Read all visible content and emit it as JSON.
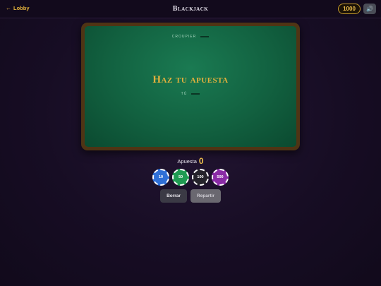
{
  "header": {
    "back_label": "Lobby",
    "back_icon": "arrow-left-icon",
    "title": "Blackjack",
    "credits": "1000",
    "sound_icon": "speaker-icon"
  },
  "table": {
    "dealer_label": "CROUPIER",
    "prompt": "Haz tu apuesta",
    "player_label": "TÚ"
  },
  "bet": {
    "label": "Apuesta",
    "amount": "0"
  },
  "chips": [
    {
      "value": "10",
      "color": "#2f6fd6"
    },
    {
      "value": "50",
      "color": "#1f9a52"
    },
    {
      "value": "100",
      "color": "#25232b"
    },
    {
      "value": "500",
      "color": "#8a2ba6"
    }
  ],
  "actions": {
    "clear_label": "Borrar",
    "deal_label": "Repartir"
  }
}
